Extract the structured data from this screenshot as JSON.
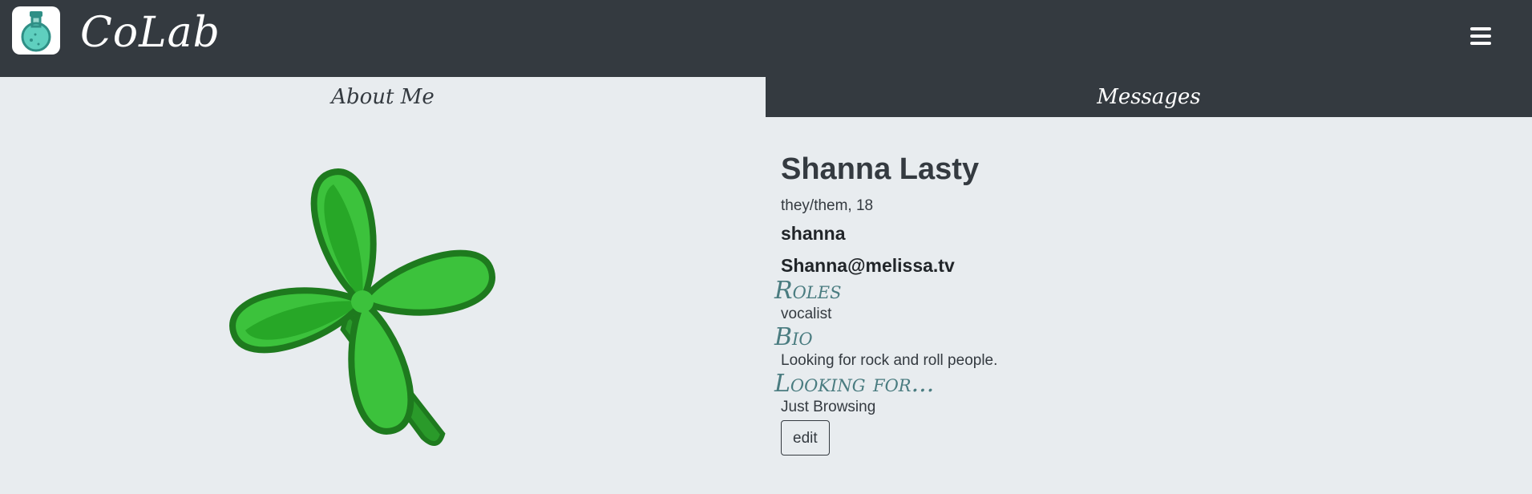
{
  "app": {
    "brand": "CoLab"
  },
  "tabs": [
    {
      "label": "About Me"
    },
    {
      "label": "Messages"
    }
  ],
  "profile": {
    "name": "Shanna Lasty",
    "pronouns_age": "they/them, 18",
    "username": "shanna",
    "email": "Shanna@melissa.tv",
    "roles_heading": "Roles",
    "roles": "vocalist",
    "bio_heading": "Bio",
    "bio": "Looking for rock and roll people.",
    "looking_heading": "Looking for...",
    "looking": "Just Browsing",
    "edit_label": "edit"
  },
  "icons": {
    "logo": "flask-icon",
    "menu": "hamburger-menu-icon",
    "avatar": "four-leaf-clover"
  },
  "colors": {
    "navbar": "#343a40",
    "background": "#e8ecef",
    "heading_accent": "#4a7c80",
    "clover_light": "#3cc23c",
    "clover_dark": "#1e7a1e"
  }
}
